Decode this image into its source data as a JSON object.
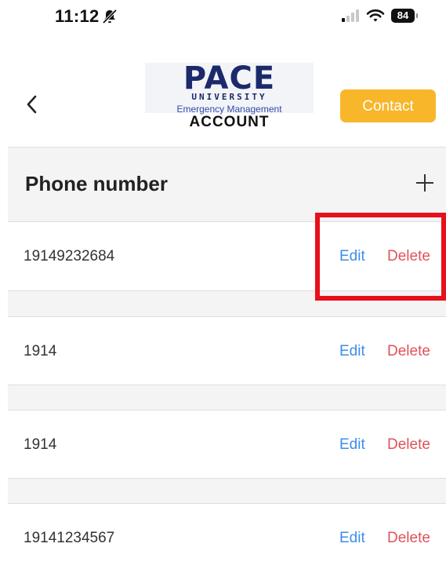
{
  "status_bar": {
    "time": "11:12",
    "battery": "84",
    "icons": [
      "bell-slash-icon",
      "signal-icon",
      "wifi-icon",
      "battery-icon"
    ]
  },
  "header": {
    "back_icon": "chevron-left-icon",
    "logo": {
      "main": "PACE",
      "university": "UNIVERSITY",
      "subtitle": "Emergency Management"
    },
    "title": "ACCOUNT",
    "contact_label": "Contact"
  },
  "section": {
    "title": "Phone number",
    "add_icon": "plus-icon"
  },
  "phones": [
    {
      "number": "19149232684",
      "edit_label": "Edit",
      "delete_label": "Delete"
    },
    {
      "number": "1914",
      "edit_label": "Edit",
      "delete_label": "Delete"
    },
    {
      "number": "1914",
      "edit_label": "Edit",
      "delete_label": "Delete"
    },
    {
      "number": "19141234567",
      "edit_label": "Edit",
      "delete_label": "Delete"
    }
  ],
  "colors": {
    "contact_button": "#f8b62a",
    "edit_link": "#3d8ee6",
    "delete_link": "#e0525a",
    "highlight": "#e8101a",
    "logo_navy": "#1c2a6b"
  }
}
